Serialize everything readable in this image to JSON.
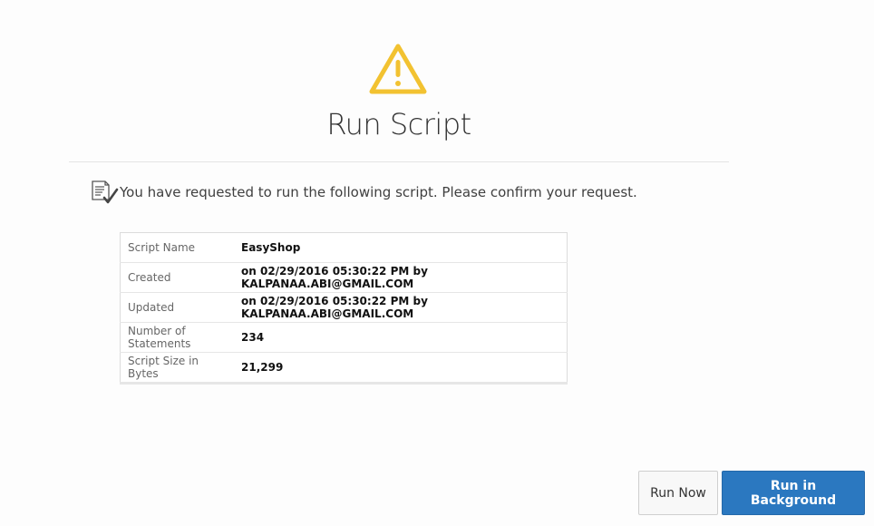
{
  "dialog": {
    "title": "Run Script",
    "message": "You have requested to run the following script. Please confirm your request.",
    "icon": "warning-icon",
    "icon_color": "#f2c231"
  },
  "details": [
    {
      "label": "Script Name",
      "value": "EasyShop"
    },
    {
      "label": "Created",
      "value": "on 02/29/2016 05:30:22 PM by KALPANAA.ABI@GMAIL.COM"
    },
    {
      "label": "Updated",
      "value": "on 02/29/2016 05:30:22 PM by KALPANAA.ABI@GMAIL.COM"
    },
    {
      "label": "Number of Statements",
      "value": "234"
    },
    {
      "label": "Script Size in Bytes",
      "value": "21,299"
    }
  ],
  "buttons": {
    "run_now": "Run Now",
    "run_in_background": "Run in Background"
  },
  "colors": {
    "primary": "#2b78c0",
    "warning": "#f2c231"
  }
}
